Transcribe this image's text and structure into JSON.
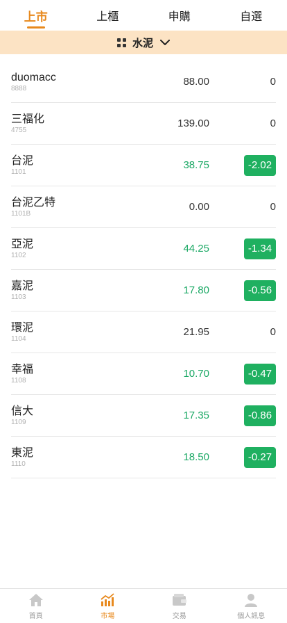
{
  "tabs": [
    {
      "label": "上市",
      "active": true
    },
    {
      "label": "上櫃",
      "active": false
    },
    {
      "label": "申購",
      "active": false
    },
    {
      "label": "自選",
      "active": false
    }
  ],
  "category": {
    "label": "水泥"
  },
  "stocks": [
    {
      "name": "duomacc",
      "code": "8888",
      "price": "88.00",
      "change": "0",
      "trend": "flat"
    },
    {
      "name": "三福化",
      "code": "4755",
      "price": "139.00",
      "change": "0",
      "trend": "flat"
    },
    {
      "name": "台泥",
      "code": "1101",
      "price": "38.75",
      "change": "-2.02",
      "trend": "down"
    },
    {
      "name": "台泥乙特",
      "code": "1101B",
      "price": "0.00",
      "change": "0",
      "trend": "flat"
    },
    {
      "name": "亞泥",
      "code": "1102",
      "price": "44.25",
      "change": "-1.34",
      "trend": "down"
    },
    {
      "name": "嘉泥",
      "code": "1103",
      "price": "17.80",
      "change": "-0.56",
      "trend": "down"
    },
    {
      "name": "環泥",
      "code": "1104",
      "price": "21.95",
      "change": "0",
      "trend": "flat"
    },
    {
      "name": "幸福",
      "code": "1108",
      "price": "10.70",
      "change": "-0.47",
      "trend": "down"
    },
    {
      "name": "信大",
      "code": "1109",
      "price": "17.35",
      "change": "-0.86",
      "trend": "down"
    },
    {
      "name": "東泥",
      "code": "1110",
      "price": "18.50",
      "change": "-0.27",
      "trend": "down"
    }
  ],
  "nav": [
    {
      "label": "首頁",
      "icon": "home-icon",
      "active": false
    },
    {
      "label": "市場",
      "icon": "market-chart-icon",
      "active": true
    },
    {
      "label": "交易",
      "icon": "wallet-icon",
      "active": false
    },
    {
      "label": "個人訊息",
      "icon": "user-icon",
      "active": false
    }
  ],
  "colors": {
    "accent": "#e8891d",
    "category_bg": "#fce3c4",
    "down_green": "#1aa864",
    "badge_green": "#1fb060",
    "inactive_icon": "#c8c8c8"
  }
}
